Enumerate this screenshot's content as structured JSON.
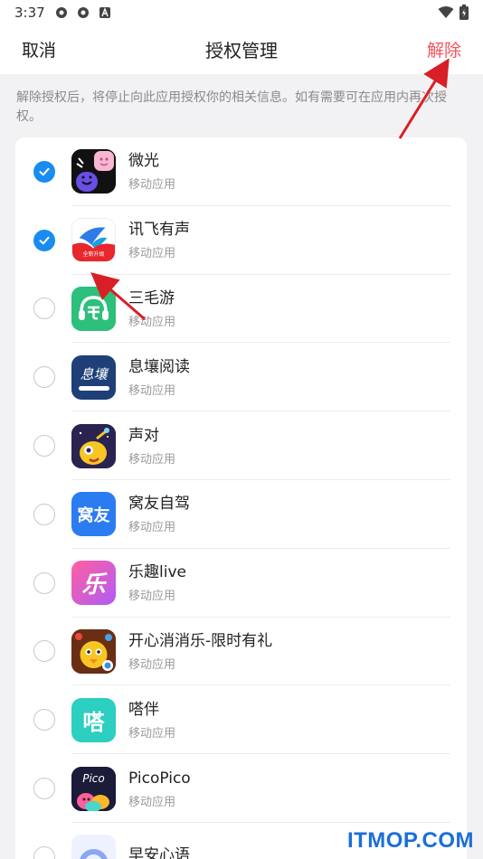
{
  "status_bar": {
    "time": "3:37"
  },
  "nav": {
    "cancel_label": "取消",
    "title": "授权管理",
    "remove_label": "解除"
  },
  "notice": "解除授权后，将停止向此应用授权你的相关信息。如有需要可在应用内再次授权。",
  "apps": [
    {
      "name": "微光",
      "sub": "移动应用",
      "checked": true,
      "icon": "weiguang-app-icon"
    },
    {
      "name": "讯飞有声",
      "sub": "移动应用",
      "checked": true,
      "icon": "xunfei-app-icon"
    },
    {
      "name": "三毛游",
      "sub": "移动应用",
      "checked": false,
      "icon": "sanmaoyou-app-icon"
    },
    {
      "name": "息壤阅读",
      "sub": "移动应用",
      "checked": false,
      "icon": "xirang-app-icon"
    },
    {
      "name": "声对",
      "sub": "移动应用",
      "checked": false,
      "icon": "shengdui-app-icon"
    },
    {
      "name": "窝友自驾",
      "sub": "移动应用",
      "checked": false,
      "icon": "woyou-app-icon"
    },
    {
      "name": "乐趣live",
      "sub": "移动应用",
      "checked": false,
      "icon": "lequ-app-icon"
    },
    {
      "name": "开心消消乐-限时有礼",
      "sub": "移动应用",
      "checked": false,
      "icon": "xiaoxiaole-app-icon"
    },
    {
      "name": "嗒伴",
      "sub": "移动应用",
      "checked": false,
      "icon": "daban-app-icon"
    },
    {
      "name": "PicoPico",
      "sub": "移动应用",
      "checked": false,
      "icon": "picopico-app-icon"
    },
    {
      "name": "早安心语",
      "sub": "",
      "checked": false,
      "icon": "zaoan-app-icon"
    }
  ],
  "icon_text": {
    "woyou": "窝友",
    "daban": "嗒",
    "lequ": "乐",
    "xirang": "息壤",
    "picopico": "Pico",
    "xunfei_banner": "全新升级"
  },
  "watermark": "ITMOP.COM",
  "colors": {
    "accent": "#1a8cf0",
    "danger": "#f2555a",
    "arrow": "#d91f26"
  }
}
